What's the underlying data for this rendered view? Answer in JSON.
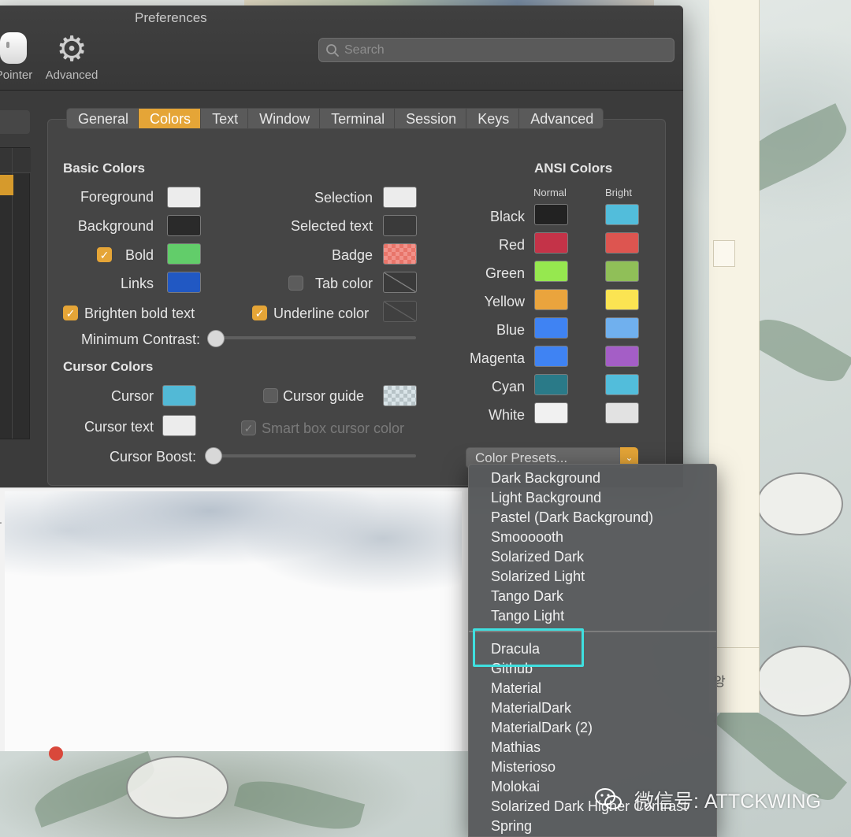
{
  "window": {
    "title": "Preferences",
    "toolbar": {
      "pointer_label": "Pointer",
      "advanced_label": "Advanced"
    },
    "search": {
      "placeholder": "Search",
      "value": ""
    }
  },
  "tabs": [
    "General",
    "Colors",
    "Text",
    "Window",
    "Terminal",
    "Session",
    "Keys",
    "Advanced"
  ],
  "active_tab": "Colors",
  "basic_colors": {
    "heading": "Basic Colors",
    "foreground": {
      "label": "Foreground",
      "color": "#ececec"
    },
    "background": {
      "label": "Background",
      "color": "#2a2a2a"
    },
    "bold": {
      "label": "Bold",
      "color": "#62cd6a",
      "checked": true
    },
    "links": {
      "label": "Links",
      "color": "#2158c3"
    },
    "selection": {
      "label": "Selection",
      "color": "#ececec"
    },
    "selected_text": {
      "label": "Selected text",
      "color": "none"
    },
    "badge": {
      "label": "Badge",
      "color": "#e8756a"
    },
    "tab_color": {
      "label": "Tab color",
      "checked": false
    },
    "brighten_bold": {
      "label": "Brighten bold text",
      "checked": true
    },
    "underline_color": {
      "label": "Underline color",
      "checked": true
    },
    "min_contrast": {
      "label": "Minimum Contrast:",
      "value": 0
    }
  },
  "cursor_colors": {
    "heading": "Cursor Colors",
    "cursor": {
      "label": "Cursor",
      "color": "#52b9d6"
    },
    "cursor_text": {
      "label": "Cursor text",
      "color": "#ececec"
    },
    "cursor_guide": {
      "label": "Cursor guide",
      "checked": false
    },
    "smart_box": {
      "label": "Smart box cursor color",
      "checked": true,
      "enabled": false
    },
    "cursor_boost": {
      "label": "Cursor Boost:",
      "value": 0
    }
  },
  "ansi": {
    "heading": "ANSI Colors",
    "normal_label": "Normal",
    "bright_label": "Bright",
    "rows": [
      {
        "name": "Black",
        "normal": "#222222",
        "bright": "#52bddb"
      },
      {
        "name": "Red",
        "normal": "#c43348",
        "bright": "#dd5550"
      },
      {
        "name": "Green",
        "normal": "#96e84f",
        "bright": "#90bf58"
      },
      {
        "name": "Yellow",
        "normal": "#eaa43d",
        "bright": "#fbe452"
      },
      {
        "name": "Blue",
        "normal": "#3f83f3",
        "bright": "#70b0ee"
      },
      {
        "name": "Magenta",
        "normal": "#3f83f3",
        "bright": "#a45ec6"
      },
      {
        "name": "Cyan",
        "normal": "#2a7a88",
        "bright": "#52bddb"
      },
      {
        "name": "White",
        "normal": "#f1f1f1",
        "bright": "#e2e2e2"
      }
    ]
  },
  "presets_button": "Color Presets...",
  "presets_menu": {
    "builtin": [
      "Dark Background",
      "Light Background",
      "Pastel (Dark Background)",
      "Smoooooth",
      "Solarized Dark",
      "Solarized Light",
      "Tango Dark",
      "Tango Light"
    ],
    "imported": [
      "Dracula",
      "Github",
      "Material",
      "MaterialDark",
      "MaterialDark (2)",
      "Mathias",
      "Misterioso",
      "Molokai",
      "Solarized Dark Higher Contrast",
      "Spring"
    ],
    "highlighted": "Dracula"
  },
  "watermark": "微信号: ATTCKWING",
  "colors": {
    "accent": "#e5a537",
    "highlight_box": "#3fe0e0"
  }
}
